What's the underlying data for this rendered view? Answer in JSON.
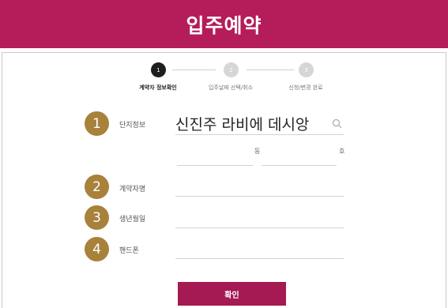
{
  "header": {
    "title": "입주예약"
  },
  "stepper": {
    "steps": [
      {
        "number": "1",
        "label": "계약자 정보확인",
        "state": "active"
      },
      {
        "number": "2",
        "label": "입주날짜 선택/취소",
        "state": "inactive"
      },
      {
        "number": "3",
        "label": "신청/변경 완료",
        "state": "inactive"
      }
    ]
  },
  "form": {
    "complex": {
      "number": "1",
      "label": "단지정보",
      "value": "신진주 라비에 데시앙",
      "icon": "search-icon"
    },
    "unit": {
      "dong_label": "동",
      "ho_label": "호",
      "dong_value": "",
      "ho_value": ""
    },
    "contractor": {
      "number": "2",
      "label": "계약자명",
      "value": ""
    },
    "birth": {
      "number": "3",
      "label": "생년월일",
      "value": ""
    },
    "phone": {
      "number": "4",
      "label": "핸드폰",
      "value": ""
    }
  },
  "actions": {
    "confirm_label": "확인"
  },
  "colors": {
    "brand": "#b51c5a",
    "badge": "#a8813a",
    "button": "#a51a53"
  }
}
